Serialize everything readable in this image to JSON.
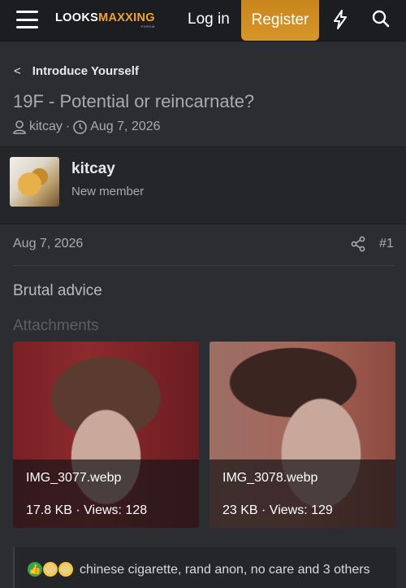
{
  "header": {
    "logo_part1": "LOOKS",
    "logo_part2": "MAXXING",
    "logo_sub": "FORUM",
    "login_label": "Log in",
    "register_label": "Register",
    "accent_color": "#d8952a"
  },
  "thread": {
    "breadcrumb": "Introduce Yourself",
    "title": "19F - Potential or reincarnate?",
    "author": "kitcay",
    "separator": "·",
    "date": "Aug 7, 2026"
  },
  "post": {
    "username": "kitcay",
    "user_role": "New member",
    "date": "Aug 7, 2026",
    "number": "#1",
    "body": "Brutal advice",
    "attachments_label": "Attachments",
    "attachments": [
      {
        "filename": "IMG_3077.webp",
        "info": "17.8 KB · Views: 128"
      },
      {
        "filename": "IMG_3078.webp",
        "info": "23 KB · Views: 129"
      }
    ],
    "reactions_text": "chinese cigarette, rand anon, no care and 3 others",
    "reaction_icons": [
      "thumbs-up-icon",
      "shocked-face-icon",
      "laughing-face-icon"
    ]
  }
}
